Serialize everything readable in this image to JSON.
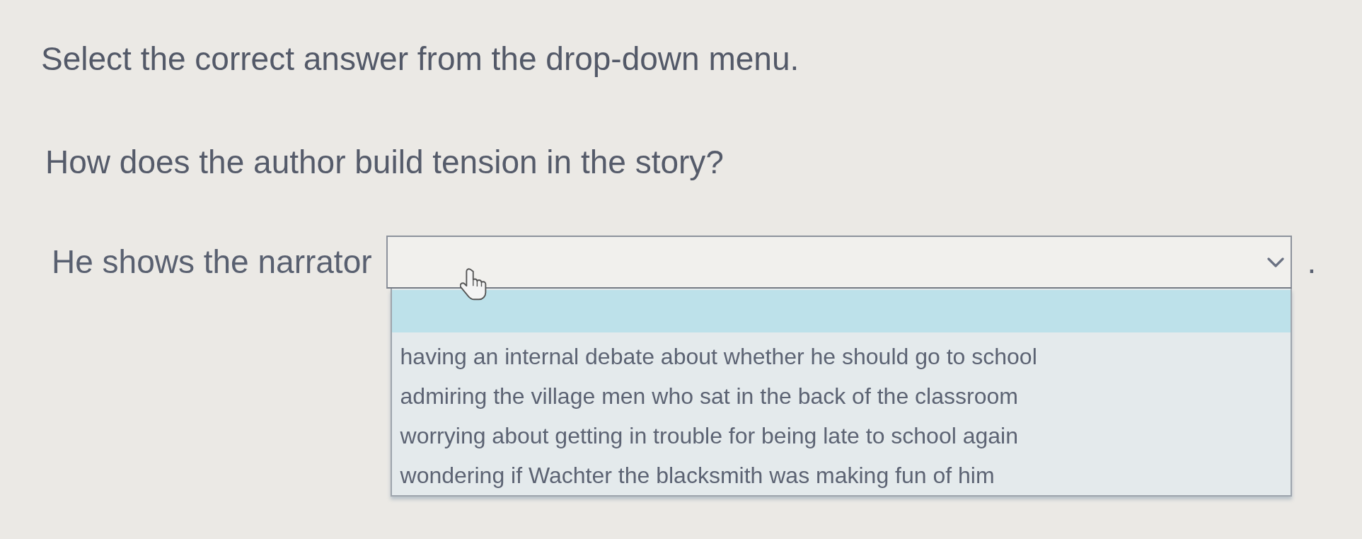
{
  "instruction": "Select the correct answer from the drop-down menu.",
  "question": "How does the author build tension in the story?",
  "answer_sentence": {
    "prefix": "He shows the narrator",
    "suffix": ".",
    "dropdown": {
      "expanded": true,
      "options": [
        {
          "selected": true
        },
        {
          "label": "having an internal debate about whether he should go to school",
          "selected": false
        },
        {
          "label": "admiring the village men who sat in the back of the classroom",
          "selected": false
        },
        {
          "label": "worrying about getting in trouble for being late to school again",
          "selected": false
        },
        {
          "label": "wondering if Wachter the blacksmith was making fun of him",
          "selected": false
        }
      ]
    }
  }
}
